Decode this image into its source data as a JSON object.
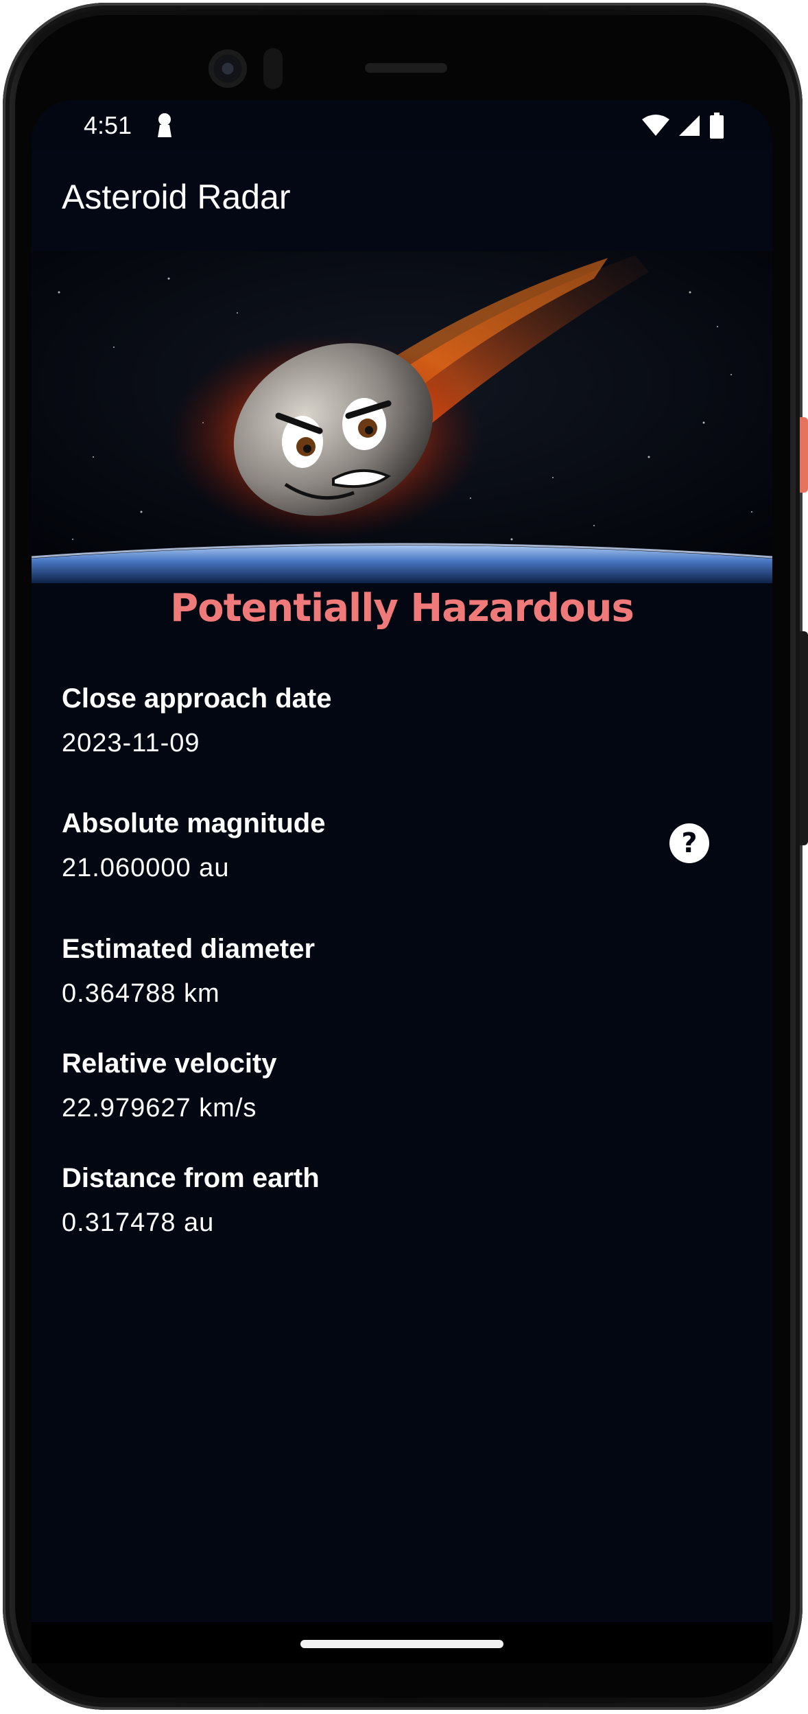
{
  "status_bar": {
    "time": "4:51",
    "icons": [
      "lock-keyhole-icon",
      "wifi-icon",
      "cell-signal-icon",
      "battery-icon"
    ]
  },
  "app_bar": {
    "title": "Asteroid Radar"
  },
  "hero": {
    "image": "angry-flaming-asteroid-over-earth"
  },
  "hazard": {
    "label": "Potentially Hazardous",
    "color": "#f07a7a"
  },
  "details": [
    {
      "label": "Close approach date",
      "value": "2023-11-09"
    },
    {
      "label": "Absolute magnitude",
      "value": "21.060000 au"
    },
    {
      "label": "Estimated diameter",
      "value": "0.364788 km"
    },
    {
      "label": "Relative velocity",
      "value": "22.979627 km/s"
    },
    {
      "label": "Distance from earth",
      "value": "0.317478 au"
    }
  ],
  "help_button": {
    "label": "?",
    "icon": "help-circle-icon"
  },
  "colors": {
    "background": "#020711",
    "text": "#ffffff",
    "accent_power_button": "#e8735d"
  }
}
